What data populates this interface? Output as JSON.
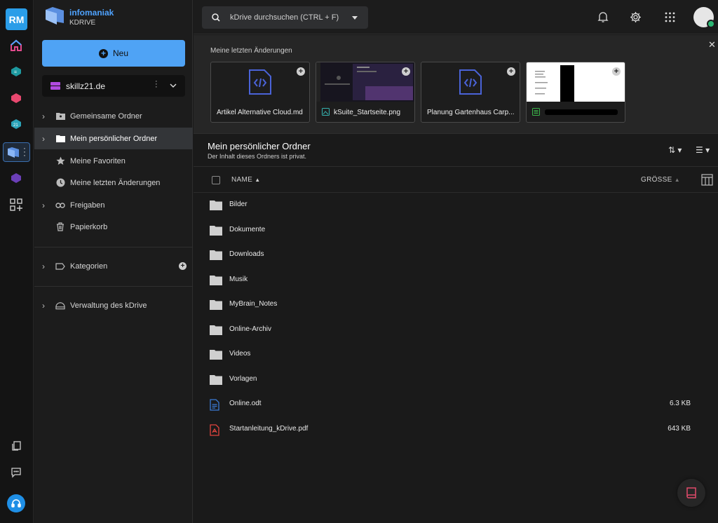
{
  "rail": {
    "avatar_initials": "RM"
  },
  "brand": {
    "name": "infomaniak",
    "product": "KDRIVE"
  },
  "sidebar": {
    "new_label": "Neu",
    "drive_name": "skillz21.de",
    "items": [
      {
        "label": "Gemeinsame Ordner",
        "icon": "shared-folder-icon"
      },
      {
        "label": "Mein persönlicher Ordner",
        "icon": "folder-icon"
      },
      {
        "label": "Meine Favoriten",
        "icon": "star-icon"
      },
      {
        "label": "Meine letzten Änderungen",
        "icon": "clock-icon"
      },
      {
        "label": "Freigaben",
        "icon": "link-icon"
      },
      {
        "label": "Papierkorb",
        "icon": "trash-icon"
      }
    ],
    "categories_label": "Kategorien",
    "admin_label": "Verwaltung des kDrive"
  },
  "search": {
    "placeholder": "kDrive durchsuchen (CTRL + F)"
  },
  "recent": {
    "title": "Meine letzten Änderungen",
    "cards": [
      {
        "label": "Artikel Alternative Cloud.md"
      },
      {
        "label": "kSuite_Startseite.png"
      },
      {
        "label": "Planung Gartenhaus Carp..."
      },
      {
        "label": ""
      }
    ]
  },
  "main": {
    "title": "Mein persönlicher Ordner",
    "subtitle": "Der Inhalt dieses Ordners ist privat.",
    "col_name": "NAME",
    "col_size": "GRÖSSE",
    "rows": [
      {
        "name": "Bilder",
        "size": "",
        "type": "folder"
      },
      {
        "name": "Dokumente",
        "size": "",
        "type": "folder"
      },
      {
        "name": "Downloads",
        "size": "",
        "type": "folder"
      },
      {
        "name": "Musik",
        "size": "",
        "type": "folder"
      },
      {
        "name": "MyBrain_Notes",
        "size": "",
        "type": "folder"
      },
      {
        "name": "Online-Archiv",
        "size": "",
        "type": "folder"
      },
      {
        "name": "Videos",
        "size": "",
        "type": "folder"
      },
      {
        "name": "Vorlagen",
        "size": "",
        "type": "folder"
      },
      {
        "name": "Online.odt",
        "size": "6.3 KB",
        "type": "doc"
      },
      {
        "name": "Startanleitung_kDrive.pdf",
        "size": "643 KB",
        "type": "pdf"
      }
    ]
  },
  "colors": {
    "accent": "#4fa3f5",
    "brand": "#4fa3ff",
    "bg": "#1a1a1a",
    "pdf": "#e0443e",
    "doc": "#3a7bd5"
  }
}
